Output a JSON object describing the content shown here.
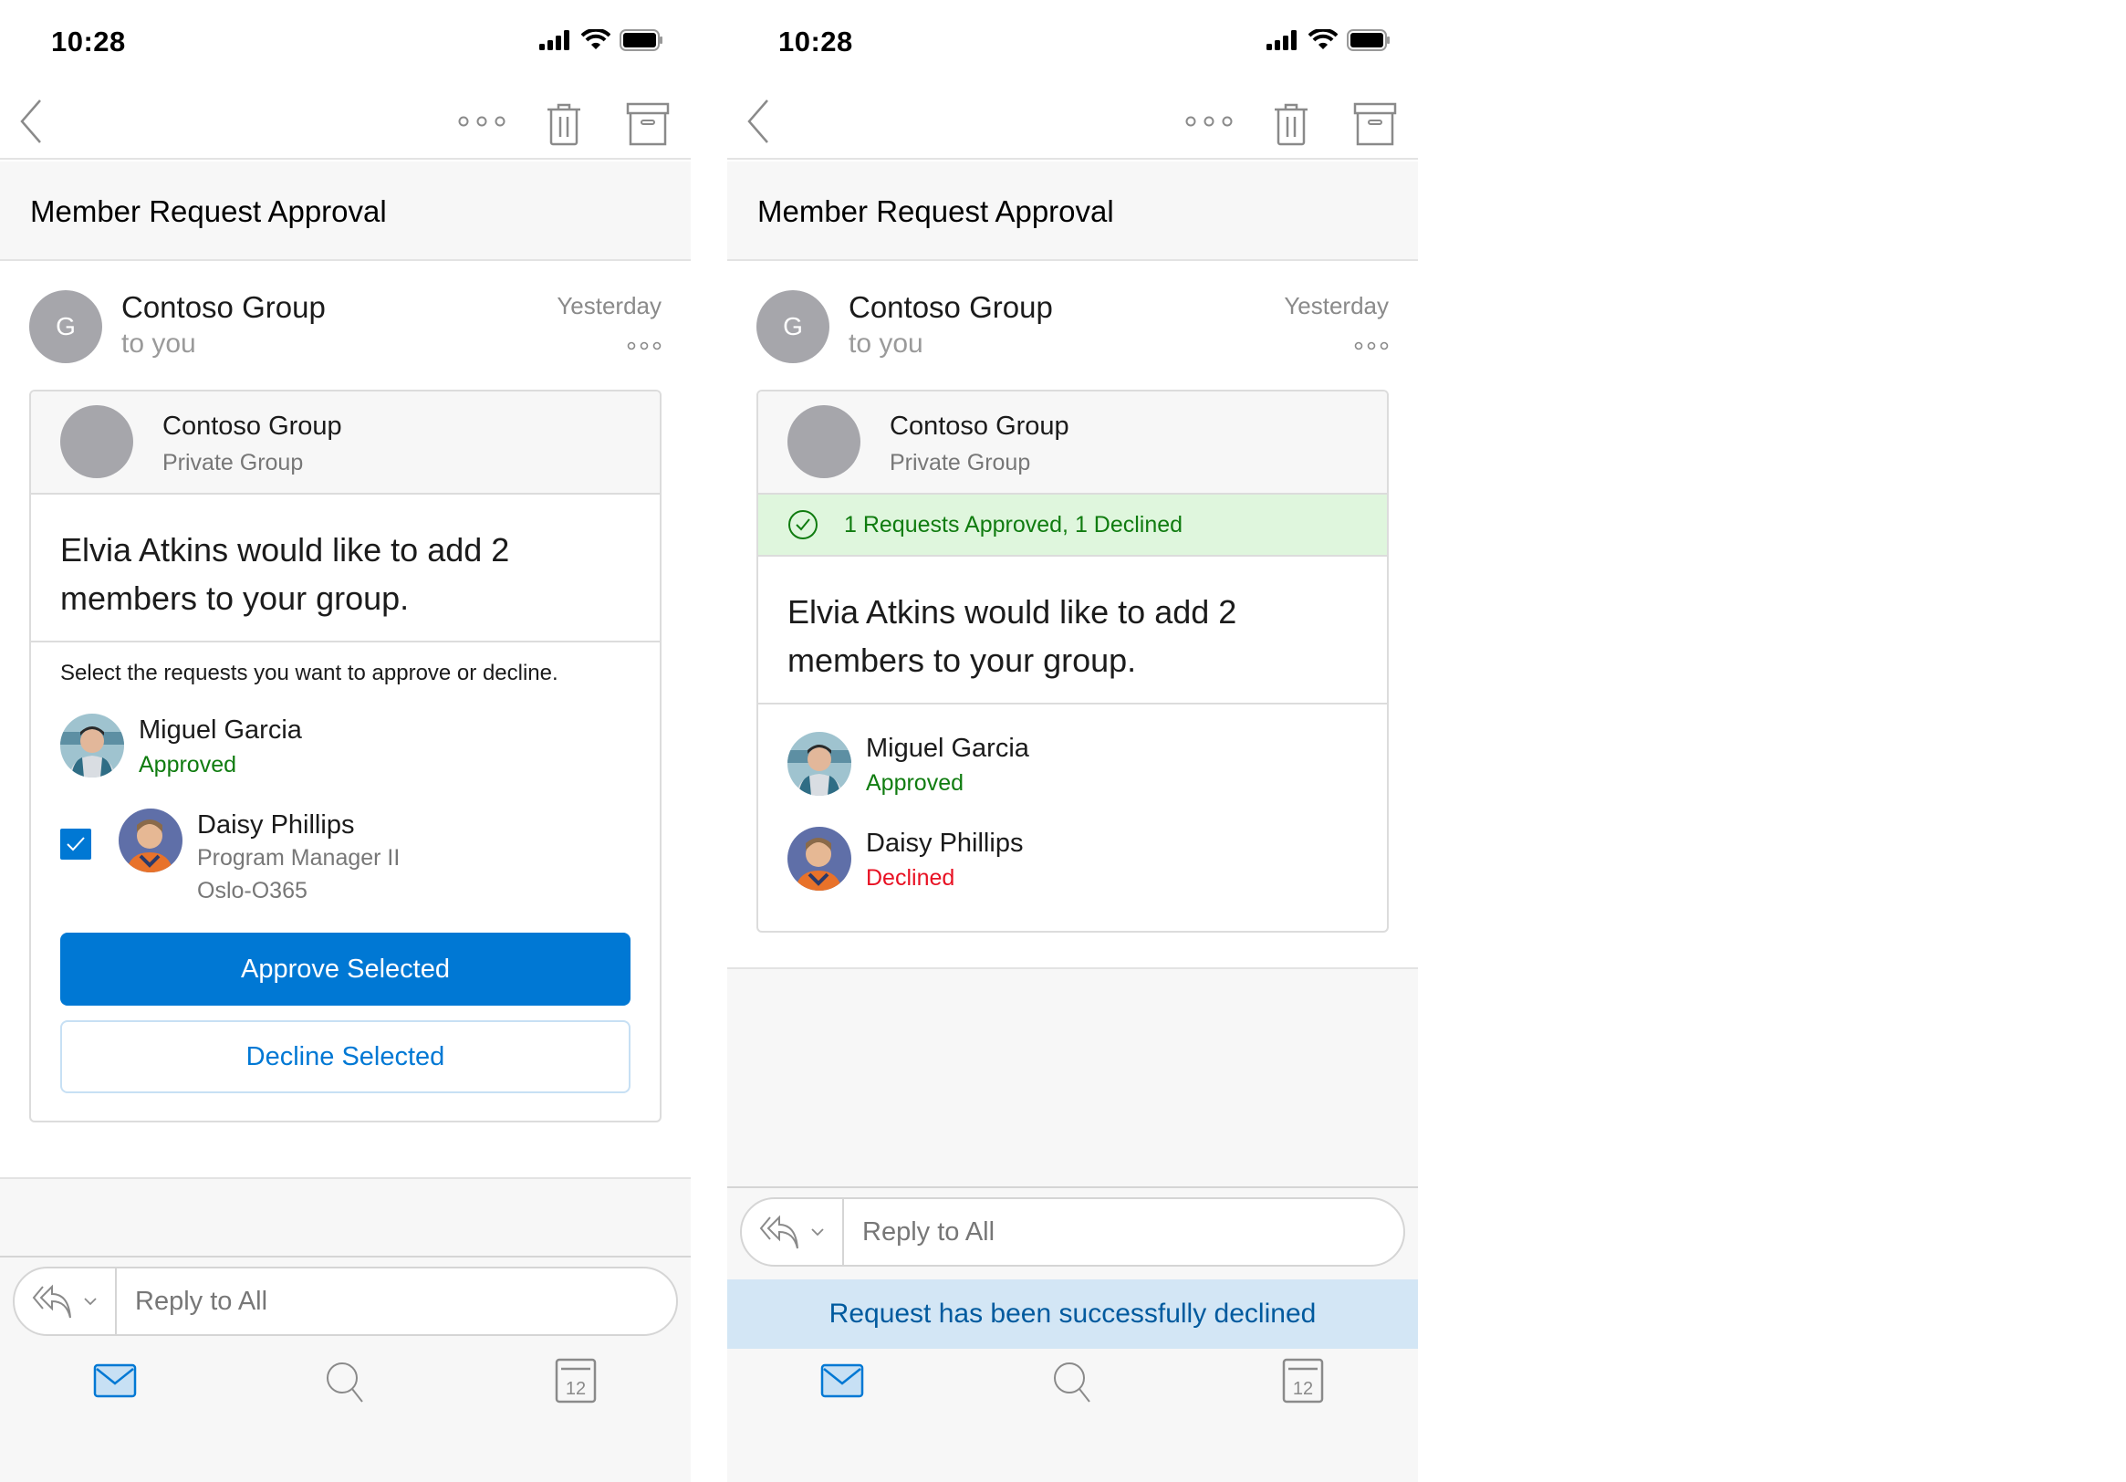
{
  "screens": [
    {
      "status_bar": {
        "time": "10:28"
      },
      "toolbar": {
        "back": "back",
        "more": "more",
        "delete": "delete",
        "archive": "archive"
      },
      "subject": "Member Request Approval",
      "sender": {
        "initial": "G",
        "name": "Contoso Group",
        "recipient": "to you",
        "date": "Yesterday"
      },
      "card": {
        "group_name": "Contoso Group",
        "group_type": "Private Group",
        "title": "Elvia Atkins would like to add 2 members to your group.",
        "instruction": "Select the requests you want to approve or decline.",
        "members": [
          {
            "name": "Miguel Garcia",
            "status": "Approved"
          },
          {
            "name": "Daisy Phillips",
            "title": "Program Manager II",
            "department": "Oslo-O365",
            "selected": true
          }
        ],
        "approve_label": "Approve Selected",
        "decline_label": "Decline Selected"
      },
      "reply": {
        "placeholder": "Reply to All"
      },
      "tabs": [
        {
          "name": "Mail",
          "active": true
        },
        {
          "name": "Search",
          "active": false
        },
        {
          "name": "Calendar",
          "day": "12",
          "active": false
        }
      ]
    },
    {
      "status_bar": {
        "time": "10:28"
      },
      "toolbar": {
        "back": "back",
        "more": "more",
        "delete": "delete",
        "archive": "archive"
      },
      "subject": "Member Request Approval",
      "sender": {
        "initial": "G",
        "name": "Contoso Group",
        "recipient": "to you",
        "date": "Yesterday"
      },
      "card": {
        "group_name": "Contoso Group",
        "group_type": "Private Group",
        "banner": "1 Requests Approved, 1 Declined",
        "title": "Elvia Atkins would like to add 2 members to your group.",
        "members": [
          {
            "name": "Miguel Garcia",
            "status": "Approved"
          },
          {
            "name": "Daisy Phillips",
            "status": "Declined"
          }
        ]
      },
      "reply": {
        "placeholder": "Reply to All"
      },
      "toast": "Request has been successfully declined",
      "tabs": [
        {
          "name": "Mail",
          "active": true
        },
        {
          "name": "Search",
          "active": false
        },
        {
          "name": "Calendar",
          "day": "12",
          "active": false
        }
      ]
    }
  ],
  "colors": {
    "accent": "#0078d4",
    "approved": "#107c10",
    "declined": "#e81123",
    "banner_bg": "#dff6dd",
    "toast_bg": "#d3e6f5"
  }
}
